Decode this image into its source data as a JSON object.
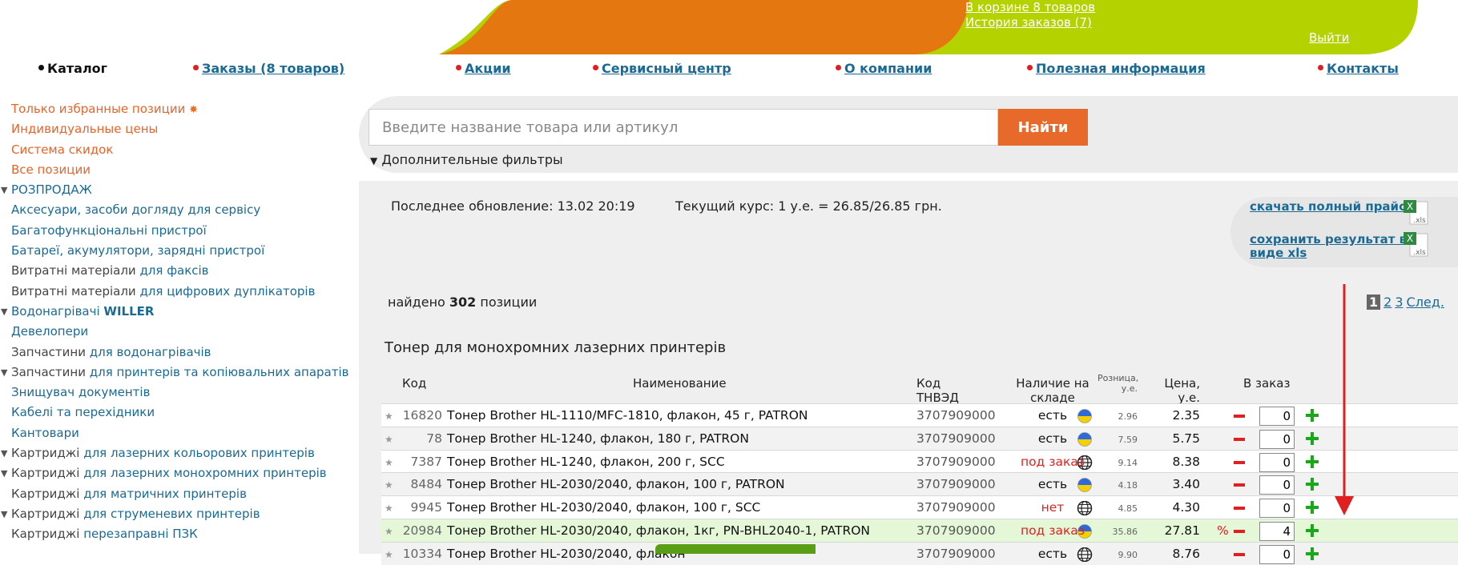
{
  "banner": {
    "cart_link": "В корзине 8 товаров",
    "history_link": "История заказов (7)",
    "logout_link": "Выйти",
    "colors": {
      "orange": "#e57710",
      "green": "#b4d100"
    }
  },
  "nav": {
    "items": [
      {
        "label": "Каталог",
        "active": true
      },
      {
        "label": "Заказы (8 товаров)"
      },
      {
        "label": "Акции"
      },
      {
        "label": "Сервисный центр"
      },
      {
        "label": "О компании"
      },
      {
        "label": "Полезная информация"
      },
      {
        "label": "Контакты"
      }
    ]
  },
  "sidebar": {
    "top_links": [
      "Только избранные позиции",
      "Индивидуальные цены",
      "Система скидок",
      "Все позиции"
    ],
    "categories": [
      {
        "pre": "",
        "post": "РОЗПРОДАЖ",
        "expandable": true
      },
      {
        "pre": "",
        "post": "Аксесуари, засоби догляду для сервісу"
      },
      {
        "pre": "",
        "post": "Багатофункціональні пристрої"
      },
      {
        "pre": "",
        "post": "Батареї, акумулятори, зарядні пристрої"
      },
      {
        "pre": "Витратні матеріали ",
        "post": "для факсів"
      },
      {
        "pre": "Витратні матеріали ",
        "post": "для цифрових дуплікаторів"
      },
      {
        "pre": "",
        "post": "Водонагрівачі ",
        "bold": "WILLER",
        "expandable": true
      },
      {
        "pre": "",
        "post": "Девелопери"
      },
      {
        "pre": "Запчастини ",
        "post": "для водонагрівачів"
      },
      {
        "pre": "Запчастини ",
        "post": "для принтерів та копіювальних апаратів",
        "expandable": true
      },
      {
        "pre": "",
        "post": "Знищувач документів"
      },
      {
        "pre": "",
        "post": "Кабелі та перехідники"
      },
      {
        "pre": "",
        "post": "Кантовари"
      },
      {
        "pre": "Картриджі ",
        "post": "для лазерних кольорових принтерів",
        "expandable": true
      },
      {
        "pre": "Картриджі ",
        "post": "для лазерних монохромних принтерів",
        "expandable": true
      },
      {
        "pre": "Картриджі ",
        "post": "для матричних принтерів"
      },
      {
        "pre": "Картриджі ",
        "post": "для струменевих принтерів",
        "expandable": true
      },
      {
        "pre": "Картриджі ",
        "post": "перезаправні ПЗК"
      }
    ]
  },
  "search": {
    "placeholder": "Введите название товара или артикул",
    "button": "Найти",
    "filters_label": "Дополнительные фильтры"
  },
  "info": {
    "last_update": "Последнее обновление: 13.02 20:19",
    "rate": "Текущий курс: 1 у.е. = 26.85/26.85 грн.",
    "download_full": "скачать полный прайс",
    "save_result": "сохранить результат в виде xls",
    "found_prefix": "найдено ",
    "found_count": "302",
    "found_suffix": " позиции"
  },
  "pagination": {
    "current": "1",
    "pages": [
      "2",
      "3"
    ],
    "next": "След."
  },
  "section_title": "Тонер для монохромних лазерних принтерів",
  "table": {
    "headers": {
      "code": "Код",
      "name": "Наименование",
      "tnved": "Код ТНВЭД",
      "stock": "Наличие на складе",
      "retail": "Розница, у.е.",
      "price": "Цена, у.е.",
      "order": "В заказ"
    },
    "rows": [
      {
        "code": "16820",
        "name": "Тонер Brother HL-1110/MFC-1810, флакон, 45 г, PATRON",
        "tnved": "3707909000",
        "origin": "ua-flag",
        "stock": "есть",
        "retail": "2.96",
        "price": "2.35",
        "qty": "0"
      },
      {
        "code": "78",
        "name": "Тонер Brother HL-1240, флакон, 180 г, PATRON",
        "tnved": "3707909000",
        "origin": "ua-flag",
        "stock": "есть",
        "retail": "7.59",
        "price": "5.75",
        "qty": "0"
      },
      {
        "code": "7387",
        "name": "Тонер Brother HL-1240, флакон, 200 г, SCC",
        "tnved": "3707909000",
        "origin": "globe",
        "stock": "под заказ",
        "retail": "9.14",
        "price": "8.38",
        "qty": "0"
      },
      {
        "code": "8484",
        "name": "Тонер Brother HL-2030/2040, флакон, 100 г, PATRON",
        "tnved": "3707909000",
        "origin": "ua-flag",
        "stock": "есть",
        "retail": "4.18",
        "price": "3.40",
        "qty": "0"
      },
      {
        "code": "9945",
        "name": "Тонер Brother HL-2030/2040, флакон, 100 г, SCC",
        "tnved": "3707909000",
        "origin": "globe",
        "stock": "нет",
        "retail": "4.85",
        "price": "4.30",
        "qty": "0"
      },
      {
        "code": "20984",
        "name": "Тонер Brother HL-2030/2040, флакон, 1кг, PN-BHL2040-1, PATRON",
        "tnved": "3707909000",
        "origin": "ua-flag",
        "stock": "под заказ",
        "retail": "35.86",
        "price": "27.81",
        "discount": "%",
        "qty": "4"
      },
      {
        "code": "10334",
        "name": "Тонер Brother HL-2030/2040, флакон",
        "tnved": "3707909000",
        "origin": "globe",
        "stock": "есть",
        "retail": "9.90",
        "price": "8.76",
        "qty": "0"
      }
    ]
  }
}
